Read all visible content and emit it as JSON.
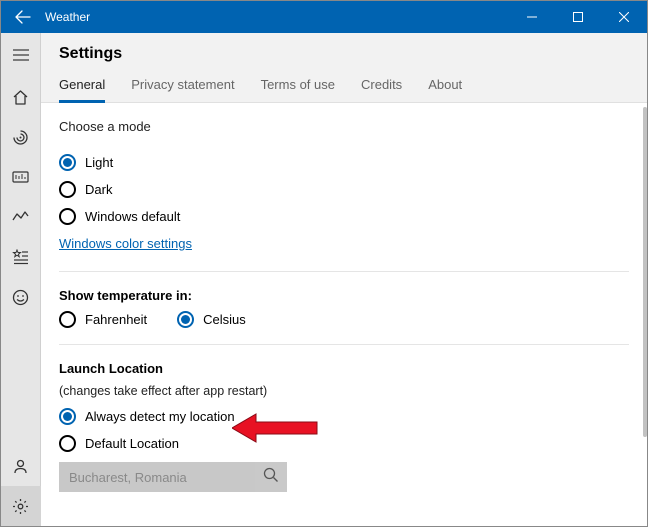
{
  "titlebar": {
    "app_name": "Weather"
  },
  "settings": {
    "title": "Settings",
    "tabs": {
      "general": "General",
      "privacy": "Privacy statement",
      "terms": "Terms of use",
      "credits": "Credits",
      "about": "About"
    }
  },
  "mode": {
    "heading": "Choose a mode",
    "light": "Light",
    "dark": "Dark",
    "default": "Windows default",
    "link": "Windows color settings"
  },
  "temp": {
    "heading": "Show temperature in:",
    "f": "Fahrenheit",
    "c": "Celsius"
  },
  "launch": {
    "heading": "Launch Location",
    "sub": "(changes take effect after app restart)",
    "detect": "Always detect my location",
    "default": "Default Location",
    "placeholder": "Bucharest, Romania"
  }
}
